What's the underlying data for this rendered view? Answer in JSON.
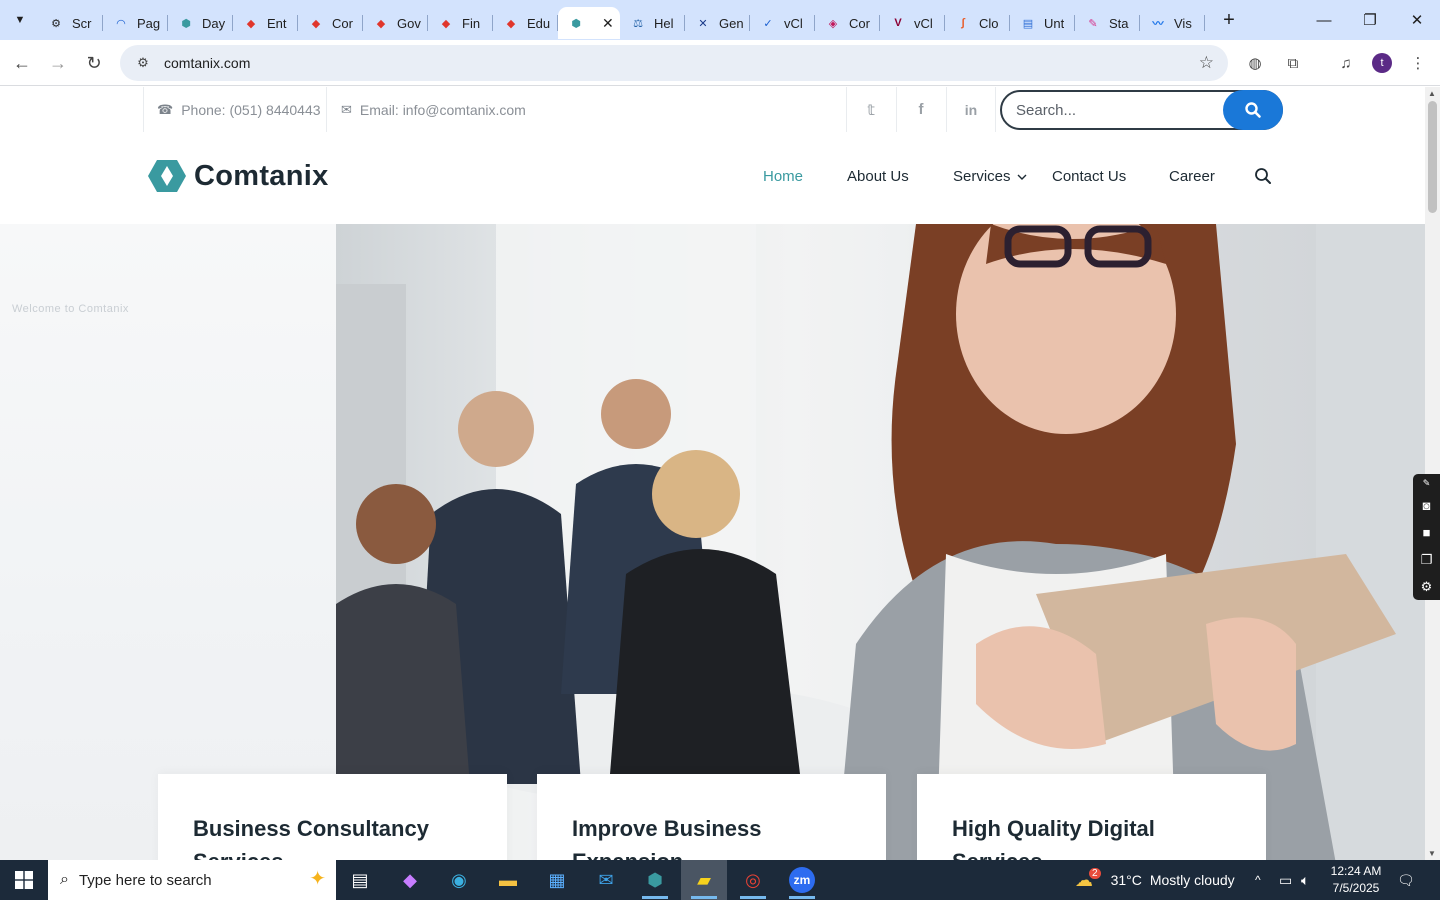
{
  "browser": {
    "tabs": [
      {
        "label": "Scr",
        "icon": "gear-face-icon"
      },
      {
        "label": "Pag",
        "icon": "gauge-icon"
      },
      {
        "label": "Day",
        "icon": "comtanix-icon"
      },
      {
        "label": "Ent",
        "icon": "diamond-red-icon"
      },
      {
        "label": "Cor",
        "icon": "diamond-red-icon"
      },
      {
        "label": "Gov",
        "icon": "diamond-red-icon"
      },
      {
        "label": "Fin",
        "icon": "diamond-red-icon"
      },
      {
        "label": "Edu",
        "icon": "diamond-red-icon"
      },
      {
        "label": "",
        "icon": "comtanix-icon",
        "active": true
      },
      {
        "label": "Hel",
        "icon": "scales-icon"
      },
      {
        "label": "Gen",
        "icon": "x-icon"
      },
      {
        "label": "vCl",
        "icon": "v-check-icon"
      },
      {
        "label": "Cor",
        "icon": "pink-logo-icon"
      },
      {
        "label": "vCl",
        "icon": "v-icon"
      },
      {
        "label": "Clo",
        "icon": "clo-icon"
      },
      {
        "label": "Unt",
        "icon": "doc-icon"
      },
      {
        "label": "Sta",
        "icon": "brush-icon"
      },
      {
        "label": "Vis",
        "icon": "pulse-icon"
      }
    ],
    "url": "comtanix.com"
  },
  "site": {
    "topbar": {
      "phone": "Phone: (051) 8440443",
      "email": "Email: info@comtanix.com",
      "search_placeholder": "Search..."
    },
    "logo_text": "Comtanix",
    "nav": {
      "home": "Home",
      "about": "About Us",
      "services": "Services",
      "contact": "Contact Us",
      "career": "Career"
    },
    "hero_tagline": "Welcome to Comtanix",
    "cards": [
      {
        "title": "Business Consultancy Services"
      },
      {
        "title": "Improve Business Expansion"
      },
      {
        "title": "High Quality Digital Services"
      }
    ],
    "accent": "#3a9aa0",
    "button_blue": "#1a78d8"
  },
  "taskbar": {
    "search_placeholder": "Type here to search",
    "weather_temp": "31°C",
    "weather_desc": "Mostly cloudy",
    "weather_badge": "2",
    "time": "12:24 AM",
    "date": "7/5/2025"
  }
}
